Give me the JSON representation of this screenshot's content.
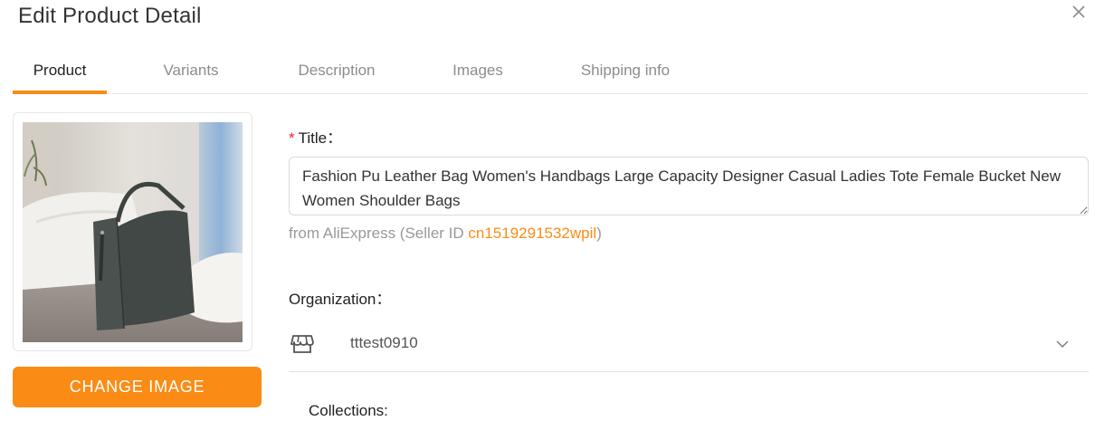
{
  "dialog": {
    "title": "Edit Product Detail",
    "close_icon": "close-icon"
  },
  "tabs": [
    {
      "label": "Product",
      "active": true
    },
    {
      "label": "Variants",
      "active": false
    },
    {
      "label": "Description",
      "active": false
    },
    {
      "label": "Images",
      "active": false
    },
    {
      "label": "Shipping info",
      "active": false
    }
  ],
  "product_image": {
    "alt_icon": "product-photo-tote-bag"
  },
  "change_image_label": "CHANGE IMAGE",
  "title_field": {
    "required_mark": "*",
    "label": "Title",
    "value": "Fashion Pu Leather Bag Women's Handbags Large Capacity Designer Casual Ladies Tote Female Bucket New Women Shoulder Bags"
  },
  "source": {
    "prefix": "from AliExpress (Seller ID ",
    "seller_id": "cn1519291532wpil",
    "suffix": ")"
  },
  "organization": {
    "label": "Organization",
    "value": "tttest0910",
    "icon": "store-icon"
  },
  "collections": {
    "label": "Collections:"
  },
  "colors": {
    "accent": "#fa8c16",
    "required": "#f5222d",
    "muted": "#999999"
  }
}
